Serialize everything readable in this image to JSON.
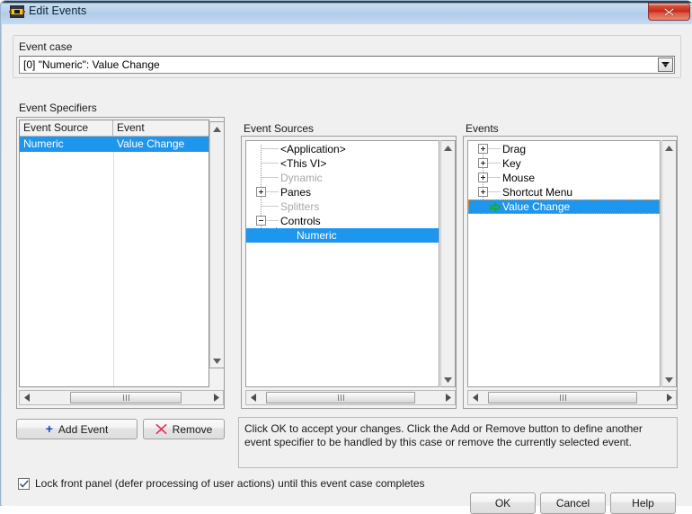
{
  "window": {
    "title": "Edit Events",
    "icon": "labview-vi-icon",
    "close_label": "x"
  },
  "event_case": {
    "label": "Event case",
    "value": "[0] \"Numeric\": Value Change",
    "dropdown_icon": "chevron-down-icon"
  },
  "specifiers": {
    "label": "Event Specifiers",
    "columns": [
      "Event Source",
      "Event"
    ],
    "rows": [
      {
        "source": "Numeric",
        "event": "Value Change",
        "selected": true
      }
    ]
  },
  "event_sources": {
    "label": "Event Sources",
    "nodes": [
      {
        "label": "<Application>",
        "depth": 1,
        "expander": "none",
        "dim": false,
        "selected": false,
        "icon": "none"
      },
      {
        "label": "<This VI>",
        "depth": 1,
        "expander": "none",
        "dim": false,
        "selected": false,
        "icon": "none"
      },
      {
        "label": "Dynamic",
        "depth": 1,
        "expander": "none",
        "dim": true,
        "selected": false,
        "icon": "none"
      },
      {
        "label": "Panes",
        "depth": 1,
        "expander": "plus",
        "dim": false,
        "selected": false,
        "icon": "none"
      },
      {
        "label": "Splitters",
        "depth": 1,
        "expander": "none",
        "dim": true,
        "selected": false,
        "icon": "none"
      },
      {
        "label": "Controls",
        "depth": 1,
        "expander": "minus",
        "dim": false,
        "selected": false,
        "icon": "none"
      },
      {
        "label": "Numeric",
        "depth": 2,
        "expander": "none",
        "dim": false,
        "selected": true,
        "icon": "none"
      }
    ]
  },
  "events": {
    "label": "Events",
    "nodes": [
      {
        "label": "Drag",
        "depth": 1,
        "expander": "plus",
        "dim": false,
        "selected": false,
        "icon": "none"
      },
      {
        "label": "Key",
        "depth": 1,
        "expander": "plus",
        "dim": false,
        "selected": false,
        "icon": "none"
      },
      {
        "label": "Mouse",
        "depth": 1,
        "expander": "plus",
        "dim": false,
        "selected": false,
        "icon": "none"
      },
      {
        "label": "Shortcut Menu",
        "depth": 1,
        "expander": "plus",
        "dim": false,
        "selected": false,
        "icon": "none"
      },
      {
        "label": "Value Change",
        "depth": 1,
        "expander": "none",
        "dim": false,
        "selected": true,
        "icon": "green-arrow-icon"
      }
    ]
  },
  "buttons": {
    "add_event": "Add Event",
    "add_event_icon": "plus-icon",
    "remove": "Remove",
    "remove_icon": "red-x-icon",
    "ok": "OK",
    "cancel": "Cancel",
    "help": "Help"
  },
  "hint": {
    "text": "Click OK to accept your changes.  Click the Add or Remove button to define another event specifier to be handled by this case or remove the currently selected event."
  },
  "lock_front_panel": {
    "label": "Lock front panel (defer processing of user actions) until this event case completes",
    "checked": true
  },
  "colors": {
    "selection_blue": "#1f96ee",
    "focus_orange": "#ff9c2a",
    "dim_gray": "#a8a8a8",
    "green_arrow": "#1e9c00",
    "red_x": "#e0305a",
    "plus_blue": "#1740c8",
    "close_red": "#c02b1a"
  }
}
